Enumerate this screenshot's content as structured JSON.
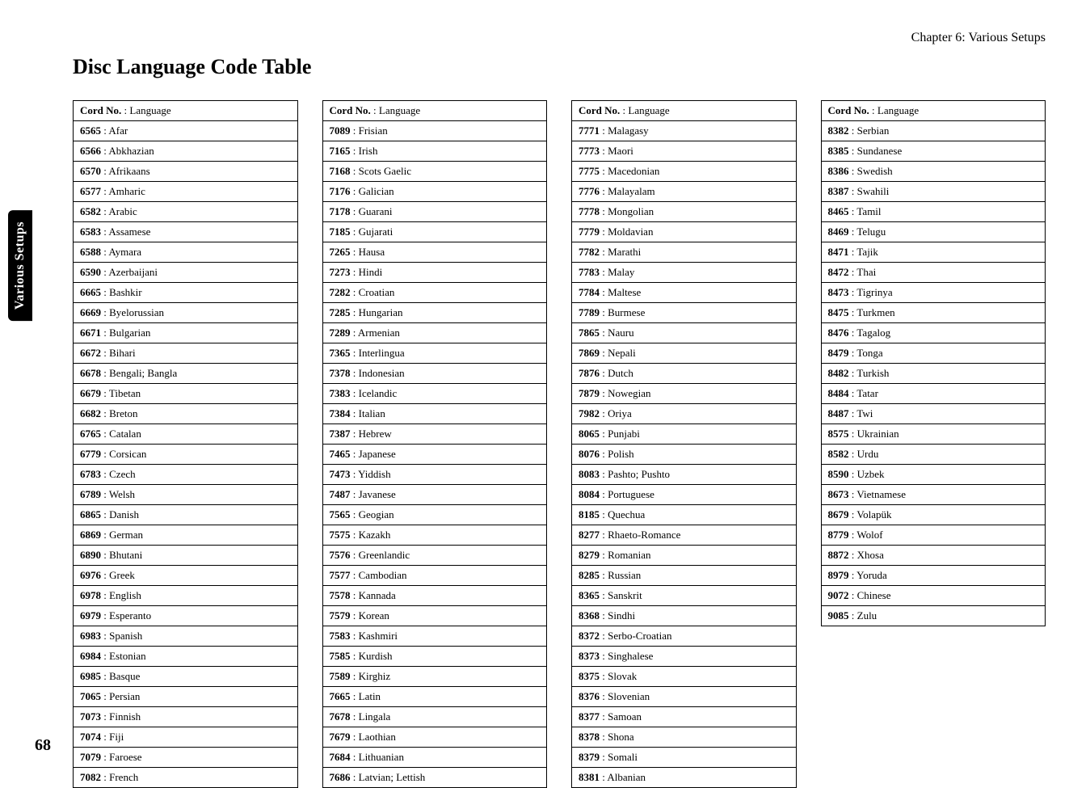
{
  "chapter_label": "Chapter 6: Various Setups",
  "title": "Disc Language Code Table",
  "side_tab": "Various Setups",
  "page_number": "68",
  "header_code": "Cord No.",
  "header_sep": " : ",
  "header_lang": "Language",
  "columns": [
    [
      {
        "code": "6565",
        "sep": " : ",
        "lang": "Afar"
      },
      {
        "code": "6566",
        "sep": " : ",
        "lang": "Abkhazian"
      },
      {
        "code": "6570",
        "sep": " : ",
        "lang": "Afrikaans"
      },
      {
        "code": "6577",
        "sep": " : ",
        "lang": "Amharic"
      },
      {
        "code": "6582",
        "sep": " : ",
        "lang": "Arabic"
      },
      {
        "code": "6583",
        "sep": " : ",
        "lang": "Assamese"
      },
      {
        "code": "6588",
        "sep": " : ",
        "lang": "Aymara"
      },
      {
        "code": "6590",
        "sep": " : ",
        "lang": "Azerbaijani"
      },
      {
        "code": "6665",
        "sep": " : ",
        "lang": "Bashkir"
      },
      {
        "code": "6669 ",
        "sep": " : ",
        "lang": "Byelorussian"
      },
      {
        "code": "6671",
        "sep": " : ",
        "lang": "Bulgarian"
      },
      {
        "code": "6672",
        "sep": " : ",
        "lang": "Bihari"
      },
      {
        "code": "6678",
        "sep": " : ",
        "lang": "Bengali; Bangla"
      },
      {
        "code": "6679",
        "sep": " : ",
        "lang": "Tibetan"
      },
      {
        "code": "6682",
        "sep": " : ",
        "lang": "Breton"
      },
      {
        "code": "6765",
        "sep": " : ",
        "lang": "Catalan"
      },
      {
        "code": "6779",
        "sep": " : ",
        "lang": "Corsican"
      },
      {
        "code": "6783",
        "sep": " : ",
        "lang": "Czech"
      },
      {
        "code": "6789",
        "sep": " : ",
        "lang": "Welsh"
      },
      {
        "code": "6865",
        "sep": " : ",
        "lang": "Danish"
      },
      {
        "code": "6869",
        "sep": " : ",
        "lang": "German"
      },
      {
        "code": "6890",
        "sep": " : ",
        "lang": "Bhutani"
      },
      {
        "code": "6976",
        "sep": " : ",
        "lang": "Greek"
      },
      {
        "code": "6978",
        "sep": " : ",
        "lang": "English"
      },
      {
        "code": "6979",
        "sep": " : ",
        "lang": "Esperanto"
      },
      {
        "code": "6983",
        "sep": " : ",
        "lang": "Spanish"
      },
      {
        "code": "6984",
        "sep": " : ",
        "lang": "Estonian"
      },
      {
        "code": "6985",
        "sep": " : ",
        "lang": "Basque"
      },
      {
        "code": "7065",
        "sep": " : ",
        "lang": "Persian"
      },
      {
        "code": "7073",
        "sep": " : ",
        "lang": "Finnish"
      },
      {
        "code": "7074",
        "sep": " : ",
        "lang": "Fiji"
      },
      {
        "code": "7079",
        "sep": " : ",
        "lang": "Faroese"
      },
      {
        "code": "7082",
        "sep": " : ",
        "lang": "French"
      }
    ],
    [
      {
        "code": "7089",
        "sep": " : ",
        "lang": "Frisian"
      },
      {
        "code": "7165",
        "sep": " : ",
        "lang": "Irish"
      },
      {
        "code": "7168",
        "sep": " : ",
        "lang": "Scots Gaelic"
      },
      {
        "code": "7176",
        "sep": " : ",
        "lang": "Galician"
      },
      {
        "code": "7178",
        "sep": " : ",
        "lang": "Guarani"
      },
      {
        "code": "7185",
        "sep": " : ",
        "lang": "Gujarati"
      },
      {
        "code": "7265",
        "sep": " : ",
        "lang": "Hausa"
      },
      {
        "code": "7273",
        "sep": " : ",
        "lang": "Hindi"
      },
      {
        "code": "7282",
        "sep": " : ",
        "lang": "Croatian"
      },
      {
        "code": "7285",
        "sep": " : ",
        "lang": "Hungarian"
      },
      {
        "code": "7289",
        "sep": " : ",
        "lang": "Armenian"
      },
      {
        "code": "7365",
        "sep": " : ",
        "lang": "Interlingua"
      },
      {
        "code": "7378",
        "sep": " : ",
        "lang": "Indonesian"
      },
      {
        "code": "7383",
        "sep": " : ",
        "lang": "Icelandic"
      },
      {
        "code": "7384",
        "sep": " : ",
        "lang": "Italian"
      },
      {
        "code": "7387",
        "sep": " : ",
        "lang": "Hebrew"
      },
      {
        "code": "7465",
        "sep": " : ",
        "lang": "Japanese"
      },
      {
        "code": "7473",
        "sep": " : ",
        "lang": "Yiddish"
      },
      {
        "code": "7487",
        "sep": " : ",
        "lang": "Javanese"
      },
      {
        "code": "7565",
        "sep": " : ",
        "lang": "Geogian"
      },
      {
        "code": "7575",
        "sep": " : ",
        "lang": "Kazakh"
      },
      {
        "code": "7576",
        "sep": " : ",
        "lang": "Greenlandic"
      },
      {
        "code": "7577",
        "sep": " : ",
        "lang": "Cambodian"
      },
      {
        "code": "7578",
        "sep": " : ",
        "lang": "Kannada"
      },
      {
        "code": "7579",
        "sep": " : ",
        "lang": "Korean"
      },
      {
        "code": "7583",
        "sep": " : ",
        "lang": "Kashmiri"
      },
      {
        "code": "7585",
        "sep": " : ",
        "lang": "Kurdish"
      },
      {
        "code": "7589",
        "sep": " : ",
        "lang": "Kirghiz"
      },
      {
        "code": "7665",
        "sep": " : ",
        "lang": "Latin"
      },
      {
        "code": "7678",
        "sep": " : ",
        "lang": "Lingala"
      },
      {
        "code": "7679",
        "sep": " : ",
        "lang": "Laothian"
      },
      {
        "code": "7684",
        "sep": " : ",
        "lang": "Lithuanian"
      },
      {
        "code": "7686 ",
        "sep": " : ",
        "lang": "Latvian; Lettish"
      }
    ],
    [
      {
        "code": "7771",
        "sep": " : ",
        "lang": "Malagasy"
      },
      {
        "code": "7773",
        "sep": " : ",
        "lang": "Maori"
      },
      {
        "code": "7775",
        "sep": " : ",
        "lang": "Macedonian"
      },
      {
        "code": "7776",
        "sep": " : ",
        "lang": "Malayalam"
      },
      {
        "code": "7778",
        "sep": " : ",
        "lang": "Mongolian"
      },
      {
        "code": "7779",
        "sep": " : ",
        "lang": "Moldavian"
      },
      {
        "code": "7782",
        "sep": " : ",
        "lang": "Marathi"
      },
      {
        "code": "7783",
        "sep": " : ",
        "lang": "Malay"
      },
      {
        "code": "7784",
        "sep": " : ",
        "lang": "Maltese"
      },
      {
        "code": "7789",
        "sep": " : ",
        "lang": "Burmese"
      },
      {
        "code": "7865",
        "sep": " : ",
        "lang": "Nauru"
      },
      {
        "code": "7869",
        "sep": " : ",
        "lang": "Nepali"
      },
      {
        "code": "7876",
        "sep": " : ",
        "lang": "Dutch"
      },
      {
        "code": "7879",
        "sep": " : ",
        "lang": "Nowegian"
      },
      {
        "code": "7982",
        "sep": " : ",
        "lang": "Oriya"
      },
      {
        "code": "8065",
        "sep": " : ",
        "lang": "Punjabi"
      },
      {
        "code": "8076",
        "sep": " : ",
        "lang": "Polish"
      },
      {
        "code": "8083",
        "sep": " : ",
        "lang": "Pashto; Pushto"
      },
      {
        "code": "8084",
        "sep": " : ",
        "lang": "Portuguese"
      },
      {
        "code": "8185",
        "sep": " : ",
        "lang": "Quechua"
      },
      {
        "code": "8277",
        "sep": " : ",
        "lang": "Rhaeto-Romance"
      },
      {
        "code": "8279",
        "sep": " : ",
        "lang": "Romanian"
      },
      {
        "code": "8285",
        "sep": " : ",
        "lang": "Russian"
      },
      {
        "code": "8365",
        "sep": " : ",
        "lang": "Sanskrit"
      },
      {
        "code": "8368",
        "sep": " : ",
        "lang": "Sindhi"
      },
      {
        "code": "8372",
        "sep": " : ",
        "lang": "Serbo-Croatian"
      },
      {
        "code": "8373",
        "sep": " : ",
        "lang": "Singhalese"
      },
      {
        "code": "8375",
        "sep": " : ",
        "lang": "Slovak"
      },
      {
        "code": "8376",
        "sep": " : ",
        "lang": "Slovenian"
      },
      {
        "code": "8377",
        "sep": " : ",
        "lang": "Samoan"
      },
      {
        "code": "8378",
        "sep": " : ",
        "lang": "Shona"
      },
      {
        "code": "8379",
        "sep": " : ",
        "lang": "Somali"
      },
      {
        "code": "8381",
        "sep": " : ",
        "lang": "Albanian"
      }
    ],
    [
      {
        "code": "8382",
        "sep": " : ",
        "lang": "Serbian"
      },
      {
        "code": "8385",
        "sep": " : ",
        "lang": "Sundanese"
      },
      {
        "code": "8386",
        "sep": " : ",
        "lang": "Swedish"
      },
      {
        "code": "8387",
        "sep": " : ",
        "lang": "Swahili"
      },
      {
        "code": "8465",
        "sep": " : ",
        "lang": "Tamil"
      },
      {
        "code": "8469",
        "sep": " : ",
        "lang": "Telugu"
      },
      {
        "code": "8471",
        "sep": " : ",
        "lang": "Tajik"
      },
      {
        "code": "8472",
        "sep": " : ",
        "lang": "Thai"
      },
      {
        "code": "8473",
        "sep": " : ",
        "lang": "Tigrinya"
      },
      {
        "code": "8475",
        "sep": " : ",
        "lang": "Turkmen"
      },
      {
        "code": "8476",
        "sep": " : ",
        "lang": "Tagalog"
      },
      {
        "code": "8479",
        "sep": " : ",
        "lang": "Tonga"
      },
      {
        "code": "8482",
        "sep": " : ",
        "lang": "Turkish"
      },
      {
        "code": "8484",
        "sep": " : ",
        "lang": "Tatar"
      },
      {
        "code": "8487",
        "sep": " : ",
        "lang": "Twi"
      },
      {
        "code": "8575",
        "sep": " : ",
        "lang": "Ukrainian"
      },
      {
        "code": "8582",
        "sep": " : ",
        "lang": "Urdu"
      },
      {
        "code": "8590",
        "sep": " : ",
        "lang": "Uzbek"
      },
      {
        "code": "8673",
        "sep": " : ",
        "lang": "Vietnamese"
      },
      {
        "code": "8679",
        "sep": " : ",
        "lang": "Volapük"
      },
      {
        "code": "8779",
        "sep": " : ",
        "lang": "Wolof"
      },
      {
        "code": "8872",
        "sep": " : ",
        "lang": "Xhosa"
      },
      {
        "code": "8979",
        "sep": " : ",
        "lang": "Yoruda"
      },
      {
        "code": "9072",
        "sep": " : ",
        "lang": "Chinese"
      },
      {
        "code": "9085",
        "sep": " : ",
        "lang": "Zulu"
      }
    ]
  ]
}
